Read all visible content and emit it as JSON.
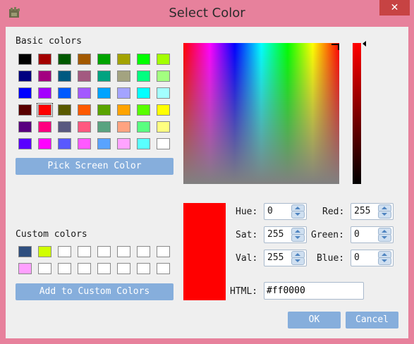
{
  "window": {
    "title": "Select Color",
    "close_glyph": "✕"
  },
  "basic": {
    "label": "Basic colors",
    "pick_button": "Pick Screen Color"
  },
  "basic_colors": [
    [
      "#000000",
      "#a30000",
      "#005900",
      "#a35900",
      "#00a300",
      "#a3a300",
      "#00ff00",
      "#a3ff00"
    ],
    [
      "#000080",
      "#a30080",
      "#005980",
      "#a35980",
      "#00a380",
      "#a3a380",
      "#00ff80",
      "#a3ff80"
    ],
    [
      "#0000ff",
      "#a300ff",
      "#0059ff",
      "#a359ff",
      "#00a3ff",
      "#a3a3ff",
      "#00ffff",
      "#a3ffff"
    ],
    [
      "#590000",
      "#ff0000",
      "#595900",
      "#ff5900",
      "#59a300",
      "#ffa300",
      "#59ff00",
      "#ffff00"
    ],
    [
      "#590080",
      "#ff0080",
      "#595980",
      "#ff5980",
      "#59a380",
      "#ffa380",
      "#59ff80",
      "#ffff80"
    ],
    [
      "#5900ff",
      "#ff00ff",
      "#5959ff",
      "#ff59ff",
      "#59a3ff",
      "#ffa3ff",
      "#59ffff",
      "#ffffff"
    ]
  ],
  "custom": {
    "label": "Custom colors",
    "add_button": "Add to Custom Colors"
  },
  "custom_colors": [
    [
      "#2f4f7f",
      "#d0ff00",
      "#ffffff",
      "#ffffff",
      "#ffffff",
      "#ffffff",
      "#ffffff",
      "#ffffff"
    ],
    [
      "#ffa0ff",
      "#ffffff",
      "#ffffff",
      "#ffffff",
      "#ffffff",
      "#ffffff",
      "#ffffff",
      "#ffffff"
    ]
  ],
  "current_color": "#ff0000",
  "fields": {
    "hue_label": "Hue:",
    "hue": "0",
    "sat_label": "Sat:",
    "sat": "255",
    "val_label": "Val:",
    "val": "255",
    "red_label": "Red:",
    "red": "255",
    "green_label": "Green:",
    "green": "0",
    "blue_label": "Blue:",
    "blue": "0",
    "html_label": "HTML:",
    "html": "#ff0000"
  },
  "buttons": {
    "ok": "OK",
    "cancel": "Cancel"
  }
}
